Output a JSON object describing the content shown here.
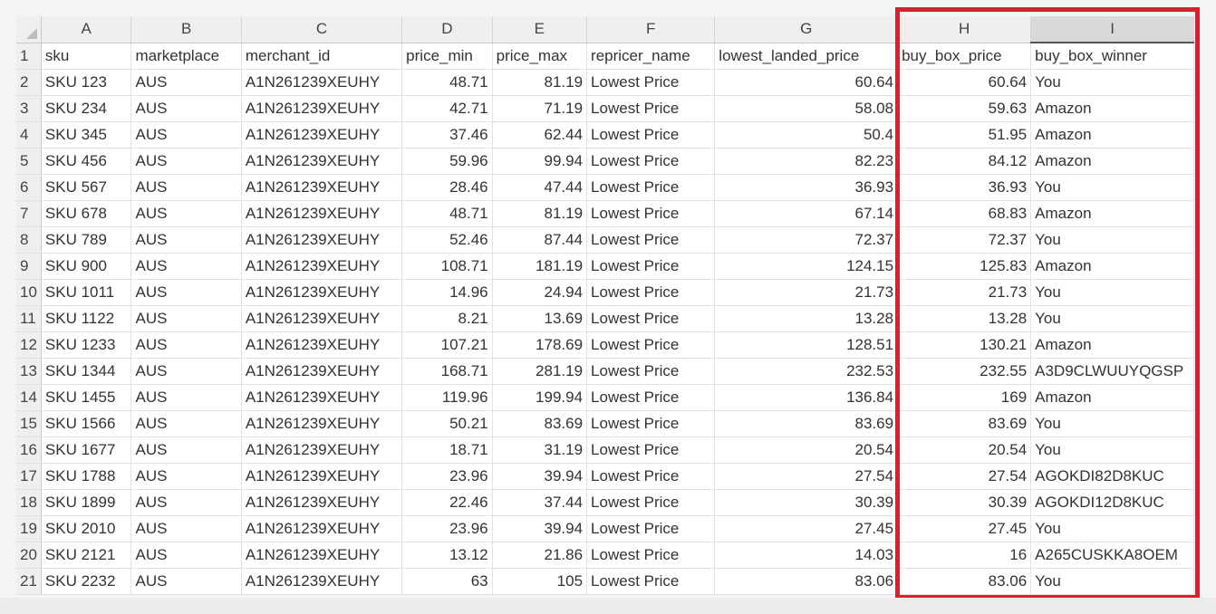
{
  "colors": {
    "highlight": "#d9202e",
    "header_bg": "#efefef",
    "selected_header_bg": "#d9d9d9"
  },
  "columns": [
    "A",
    "B",
    "C",
    "D",
    "E",
    "F",
    "G",
    "H",
    "I"
  ],
  "selected_column": "I",
  "headers": [
    "sku",
    "marketplace",
    "merchant_id",
    "price_min",
    "price_max",
    "repricer_name",
    "lowest_landed_price",
    "buy_box_price",
    "buy_box_winner"
  ],
  "rows": [
    [
      "SKU 123",
      "AUS",
      "A1N261239XEUHY",
      "48.71",
      "81.19",
      "Lowest Price",
      "60.64",
      "60.64",
      "You"
    ],
    [
      "SKU 234",
      "AUS",
      "A1N261239XEUHY",
      "42.71",
      "71.19",
      "Lowest Price",
      "58.08",
      "59.63",
      "Amazon"
    ],
    [
      "SKU 345",
      "AUS",
      "A1N261239XEUHY",
      "37.46",
      "62.44",
      "Lowest Price",
      "50.4",
      "51.95",
      "Amazon"
    ],
    [
      "SKU 456",
      "AUS",
      "A1N261239XEUHY",
      "59.96",
      "99.94",
      "Lowest Price",
      "82.23",
      "84.12",
      "Amazon"
    ],
    [
      "SKU 567",
      "AUS",
      "A1N261239XEUHY",
      "28.46",
      "47.44",
      "Lowest Price",
      "36.93",
      "36.93",
      "You"
    ],
    [
      "SKU 678",
      "AUS",
      "A1N261239XEUHY",
      "48.71",
      "81.19",
      "Lowest Price",
      "67.14",
      "68.83",
      "Amazon"
    ],
    [
      "SKU 789",
      "AUS",
      "A1N261239XEUHY",
      "52.46",
      "87.44",
      "Lowest Price",
      "72.37",
      "72.37",
      "You"
    ],
    [
      "SKU 900",
      "AUS",
      "A1N261239XEUHY",
      "108.71",
      "181.19",
      "Lowest Price",
      "124.15",
      "125.83",
      "Amazon"
    ],
    [
      "SKU 1011",
      "AUS",
      "A1N261239XEUHY",
      "14.96",
      "24.94",
      "Lowest Price",
      "21.73",
      "21.73",
      "You"
    ],
    [
      "SKU 1122",
      "AUS",
      "A1N261239XEUHY",
      "8.21",
      "13.69",
      "Lowest Price",
      "13.28",
      "13.28",
      "You"
    ],
    [
      "SKU 1233",
      "AUS",
      "A1N261239XEUHY",
      "107.21",
      "178.69",
      "Lowest Price",
      "128.51",
      "130.21",
      "Amazon"
    ],
    [
      "SKU 1344",
      "AUS",
      "A1N261239XEUHY",
      "168.71",
      "281.19",
      "Lowest Price",
      "232.53",
      "232.55",
      "A3D9CLWUUYQGSP"
    ],
    [
      "SKU 1455",
      "AUS",
      "A1N261239XEUHY",
      "119.96",
      "199.94",
      "Lowest Price",
      "136.84",
      "169",
      "Amazon"
    ],
    [
      "SKU 1566",
      "AUS",
      "A1N261239XEUHY",
      "50.21",
      "83.69",
      "Lowest Price",
      "83.69",
      "83.69",
      "You"
    ],
    [
      "SKU 1677",
      "AUS",
      "A1N261239XEUHY",
      "18.71",
      "31.19",
      "Lowest Price",
      "20.54",
      "20.54",
      "You"
    ],
    [
      "SKU 1788",
      "AUS",
      "A1N261239XEUHY",
      "23.96",
      "39.94",
      "Lowest Price",
      "27.54",
      "27.54",
      "AGOKDI82D8KUC"
    ],
    [
      "SKU 1899",
      "AUS",
      "A1N261239XEUHY",
      "22.46",
      "37.44",
      "Lowest Price",
      "30.39",
      "30.39",
      "AGOKDI12D8KUC"
    ],
    [
      "SKU 2010",
      "AUS",
      "A1N261239XEUHY",
      "23.96",
      "39.94",
      "Lowest Price",
      "27.45",
      "27.45",
      "You"
    ],
    [
      "SKU 2121",
      "AUS",
      "A1N261239XEUHY",
      "13.12",
      "21.86",
      "Lowest Price",
      "14.03",
      "16",
      "A265CUSKKA8OEM"
    ],
    [
      "SKU 2232",
      "AUS",
      "A1N261239XEUHY",
      "63",
      "105",
      "Lowest Price",
      "83.06",
      "83.06",
      "You"
    ]
  ],
  "numeric_columns": [
    3,
    4,
    6,
    7
  ]
}
